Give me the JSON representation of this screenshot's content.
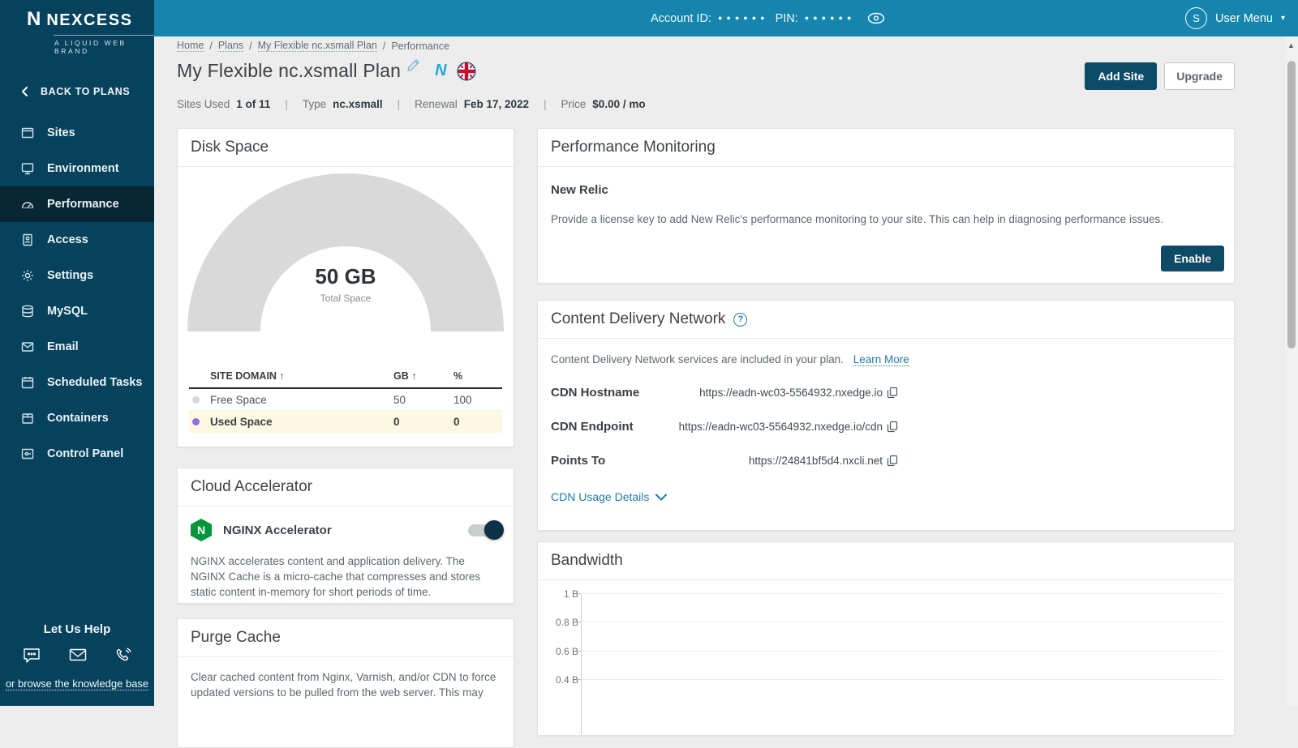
{
  "colors": {
    "topbar": "#1585ad",
    "sidebar": "#07425d",
    "sidebar_active": "#092634",
    "button_dark": "#0d4a66",
    "link_blue": "#2679a6",
    "nginx_green": "#009639",
    "free_dot": "#d8d8d8",
    "used_dot": "#8f6fe4",
    "highlight_row": "#fcf9e3",
    "gauge_gray": "#d9d9d9"
  },
  "logo": {
    "mark": "N",
    "brand": "NEXCESS",
    "tagline": "A LIQUID WEB BRAND"
  },
  "topbar": {
    "account_label": "Account ID:",
    "account_masked": "●●●●●●",
    "pin_label": "PIN:",
    "pin_masked": "●●●●●●",
    "eye_icon": "eye-icon",
    "avatar_initial": "S",
    "user_menu_label": "User Menu",
    "caret": "▾"
  },
  "sidebar": {
    "back_label": "BACK TO PLANS",
    "items": [
      {
        "label": "Sites",
        "icon": "window-icon",
        "active": false
      },
      {
        "label": "Environment",
        "icon": "monitor-icon",
        "active": false
      },
      {
        "label": "Performance",
        "icon": "speedometer-icon",
        "active": true
      },
      {
        "label": "Access",
        "icon": "id-badge-icon",
        "active": false
      },
      {
        "label": "Settings",
        "icon": "gear-icon",
        "active": false
      },
      {
        "label": "MySQL",
        "icon": "database-icon",
        "active": false
      },
      {
        "label": "Email",
        "icon": "envelope-icon",
        "active": false
      },
      {
        "label": "Scheduled Tasks",
        "icon": "calendar-icon",
        "active": false
      },
      {
        "label": "Containers",
        "icon": "box-icon",
        "active": false
      },
      {
        "label": "Control Panel",
        "icon": "panel-icon",
        "active": false
      }
    ],
    "help": {
      "title": "Let Us Help",
      "icons": [
        "chat-icon",
        "mail-icon",
        "phone-icon"
      ],
      "kb_link": "or browse the knowledge base"
    }
  },
  "breadcrumb": {
    "links": [
      "Home",
      "Plans",
      "My Flexible nc.xsmall Plan"
    ],
    "current": "Performance",
    "separator": "/"
  },
  "header": {
    "title": "My Flexible nc.xsmall Plan",
    "badges": [
      "edit-pencil-icon",
      "nexcess-n-icon",
      "uk-flag-icon"
    ],
    "add_site_label": "Add Site",
    "upgrade_label": "Upgrade",
    "meta": [
      {
        "label": "Sites Used",
        "value": "1 of 11"
      },
      {
        "label": "Type",
        "value": "nc.xsmall"
      },
      {
        "label": "Renewal",
        "value": "Feb 17, 2022"
      },
      {
        "label": "Price",
        "value": "$0.00 / mo"
      }
    ],
    "meta_separator": "|"
  },
  "disk_space": {
    "title": "Disk Space",
    "gauge_value": "50 GB",
    "gauge_label": "Total Space",
    "table": {
      "headers": [
        "SITE DOMAIN ↑",
        "GB ↑",
        "%"
      ],
      "rows": [
        {
          "label": "Free Space",
          "gb": "50",
          "pct": "100"
        },
        {
          "label": "Used Space",
          "gb": "0",
          "pct": "0"
        }
      ]
    }
  },
  "cloud_accelerator": {
    "title": "Cloud Accelerator",
    "feature_label": "NGINX Accelerator",
    "toggle_on": true,
    "description": "NGINX accelerates content and application delivery. The NGINX Cache is a micro-cache that compresses and stores static content in-memory for short periods of time."
  },
  "purge_cache": {
    "title": "Purge Cache",
    "description": "Clear cached content from Nginx, Varnish, and/or CDN to force updated versions to be pulled from the web server. This may"
  },
  "performance_monitoring": {
    "title": "Performance Monitoring",
    "subtitle": "New Relic",
    "description": "Provide a license key to add New Relic's performance monitoring to your site. This can help in diagnosing performance issues.",
    "enable_label": "Enable"
  },
  "cdn": {
    "title": "Content Delivery Network",
    "intro": "Content Delivery Network services are included in your plan.",
    "learn_more_label": "Learn More",
    "rows": [
      {
        "label": "CDN Hostname",
        "value": "https://eadn-wc03-5564932.nxedge.io"
      },
      {
        "label": "CDN Endpoint",
        "value": "https://eadn-wc03-5564932.nxedge.io/cdn"
      },
      {
        "label": "Points To",
        "value": "https://24841bf5d4.nxcli.net"
      }
    ],
    "usage_details_label": "CDN Usage Details"
  },
  "bandwidth": {
    "title": "Bandwidth"
  },
  "chart_data": {
    "type": "line",
    "title": "Bandwidth",
    "xlabel": "",
    "ylabel": "",
    "yticks": [
      "1 B",
      "0.8 B",
      "0.6 B",
      "0.4 B"
    ],
    "ylim": [
      0,
      1
    ],
    "grid": true,
    "series": []
  }
}
